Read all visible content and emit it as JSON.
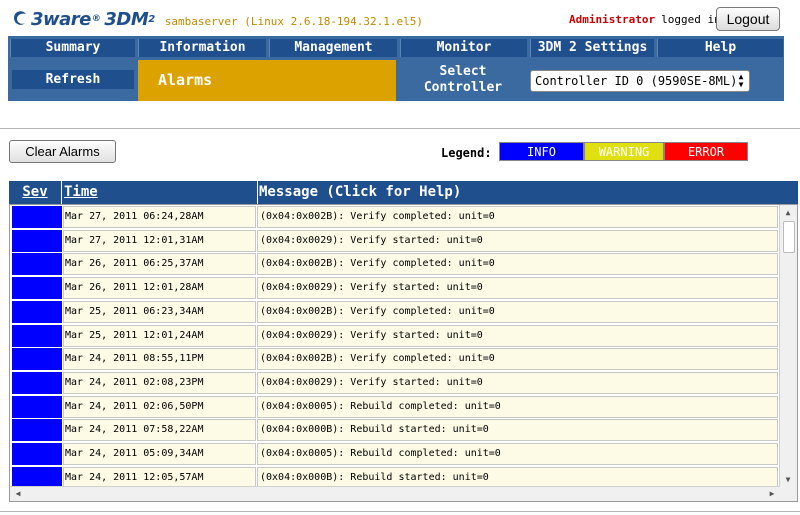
{
  "header": {
    "brand": "3ware",
    "product": "3DM",
    "version": "2",
    "host": "sambaserver (Linux 2.6.18-194.32.1.el5)",
    "user": "Administrator",
    "logged_in": "logged in",
    "logout_label": "Logout"
  },
  "nav": {
    "items": [
      {
        "label": "Summary"
      },
      {
        "label": "Information"
      },
      {
        "label": "Management"
      },
      {
        "label": "Monitor"
      },
      {
        "label": "3DM 2 Settings"
      },
      {
        "label": "Help"
      }
    ],
    "refresh_label": "Refresh",
    "current_page": "Alarms",
    "select_controller_label": "Select Controller",
    "controller_value": "Controller ID 0 (9590SE-8ML)"
  },
  "toolbar": {
    "clear_label": "Clear Alarms",
    "legend_label": "Legend:",
    "legend": {
      "info": "INFO",
      "warning": "WARNING",
      "error": "ERROR"
    }
  },
  "colors": {
    "info": "#0000ff",
    "warning": "#e0e010",
    "error": "#ff0000",
    "nav": "#1f4f8c",
    "active": "#dca300"
  },
  "table": {
    "headers": {
      "sev": "Sev",
      "time": "Time",
      "message": "Message (Click for Help)"
    },
    "rows": [
      {
        "sev": "info",
        "time": "Mar 27, 2011 06:24,28AM",
        "message": "(0x04:0x002B): Verify completed: unit=0"
      },
      {
        "sev": "info",
        "time": "Mar 27, 2011 12:01,31AM",
        "message": "(0x04:0x0029): Verify started: unit=0"
      },
      {
        "sev": "info",
        "time": "Mar 26, 2011 06:25,37AM",
        "message": "(0x04:0x002B): Verify completed: unit=0"
      },
      {
        "sev": "info",
        "time": "Mar 26, 2011 12:01,28AM",
        "message": "(0x04:0x0029): Verify started: unit=0"
      },
      {
        "sev": "info",
        "time": "Mar 25, 2011 06:23,34AM",
        "message": "(0x04:0x002B): Verify completed: unit=0"
      },
      {
        "sev": "info",
        "time": "Mar 25, 2011 12:01,24AM",
        "message": "(0x04:0x0029): Verify started: unit=0"
      },
      {
        "sev": "info",
        "time": "Mar 24, 2011 08:55,11PM",
        "message": "(0x04:0x002B): Verify completed: unit=0"
      },
      {
        "sev": "info",
        "time": "Mar 24, 2011 02:08,23PM",
        "message": "(0x04:0x0029): Verify started: unit=0"
      },
      {
        "sev": "info",
        "time": "Mar 24, 2011 02:06,50PM",
        "message": "(0x04:0x0005): Rebuild completed: unit=0"
      },
      {
        "sev": "info",
        "time": "Mar 24, 2011 07:58,22AM",
        "message": "(0x04:0x000B): Rebuild started: unit=0"
      },
      {
        "sev": "info",
        "time": "Mar 24, 2011 05:09,34AM",
        "message": "(0x04:0x0005): Rebuild completed: unit=0"
      },
      {
        "sev": "info",
        "time": "Mar 24, 2011 12:05,57AM",
        "message": "(0x04:0x000B): Rebuild started: unit=0"
      }
    ]
  }
}
